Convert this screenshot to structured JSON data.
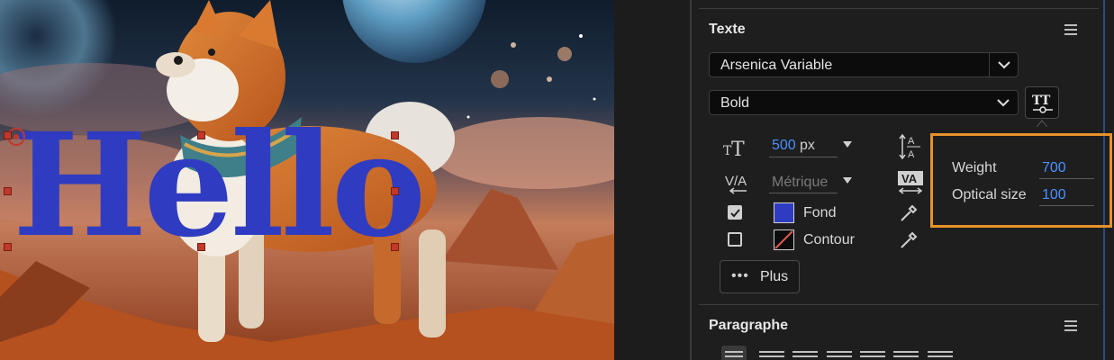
{
  "canvas": {
    "text": "Hello"
  },
  "text_section": {
    "title": "Texte",
    "font_family": "Arsenica Variable",
    "font_style": "Bold",
    "font_size": "500",
    "font_size_unit": "px",
    "kerning": "Métrique",
    "fill": {
      "checked": true,
      "label": "Fond",
      "color": "#2f3cc2"
    },
    "stroke": {
      "checked": false,
      "label": "Contour"
    },
    "more_label": "Plus",
    "more_dots": "•••"
  },
  "variable_axes": [
    {
      "name": "Weight",
      "value": "700"
    },
    {
      "name": "Optical size",
      "value": "100"
    }
  ],
  "paragraph_section": {
    "title": "Paragraphe"
  },
  "colors": {
    "accent_blue": "#4a90ff",
    "highlight_orange": "#e8922b",
    "handle_red": "#c0392b"
  }
}
